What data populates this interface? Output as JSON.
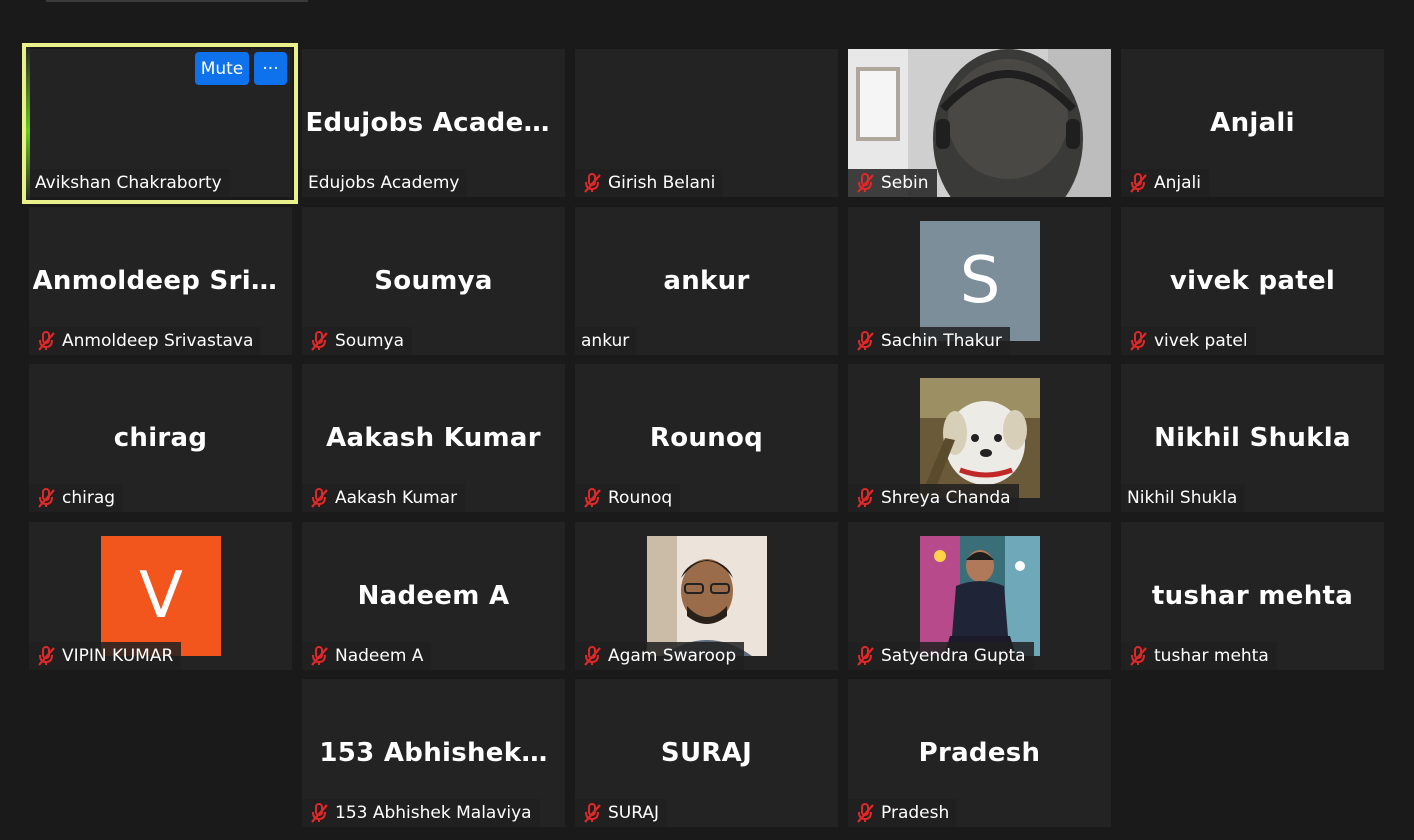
{
  "active_speaker": {
    "mute_label": "Mute",
    "more_label": "···"
  },
  "tiles": [
    {
      "big": "",
      "tag": "Avikshan Chakraborty",
      "muted": false
    },
    {
      "big": "Edujobs Academy",
      "tag": "Edujobs Academy",
      "muted": false
    },
    {
      "big": "",
      "tag": "Girish Belani",
      "muted": true
    },
    {
      "big": "",
      "tag": "Sebin",
      "muted": true
    },
    {
      "big": "Anjali",
      "tag": "Anjali",
      "muted": true
    },
    {
      "big": "Anmoldeep  Sriv…",
      "tag": "Anmoldeep Srivastava",
      "muted": true
    },
    {
      "big": "Soumya",
      "tag": "Soumya",
      "muted": true
    },
    {
      "big": "ankur",
      "tag": "ankur",
      "muted": false
    },
    {
      "big": "",
      "tag": "Sachin Thakur",
      "muted": true,
      "avatar_letter": "S"
    },
    {
      "big": "vivek patel",
      "tag": "vivek patel",
      "muted": true
    },
    {
      "big": "chirag",
      "tag": "chirag",
      "muted": true
    },
    {
      "big": "Aakash Kumar",
      "tag": "Aakash Kumar",
      "muted": true
    },
    {
      "big": "Rounoq",
      "tag": "Rounoq",
      "muted": true
    },
    {
      "big": "",
      "tag": "Shreya Chanda",
      "muted": true
    },
    {
      "big": "Nikhil Shukla",
      "tag": "Nikhil Shukla",
      "muted": false
    },
    {
      "big": "",
      "tag": "VIPIN KUMAR",
      "muted": true,
      "avatar_letter": "V"
    },
    {
      "big": "Nadeem A",
      "tag": "Nadeem A",
      "muted": true
    },
    {
      "big": "",
      "tag": "Agam Swaroop",
      "muted": true
    },
    {
      "big": "",
      "tag": "Satyendra Gupta",
      "muted": true
    },
    {
      "big": "tushar mehta",
      "tag": "tushar mehta",
      "muted": true
    },
    {
      "big": "153  Abhishek…",
      "tag": "153 Abhishek Malaviya",
      "muted": true
    },
    {
      "big": "SURAJ",
      "tag": "SURAJ",
      "muted": true
    },
    {
      "big": "Pradesh",
      "tag": "Pradesh",
      "muted": true
    }
  ],
  "colors": {
    "background": "#1a1a1a",
    "tile": "#232323",
    "active_border": "#eaf08a",
    "mute_red": "#e02828",
    "button_blue": "#0e72ed",
    "avatar_s": "#7b8e99",
    "avatar_v": "#f2561d"
  }
}
